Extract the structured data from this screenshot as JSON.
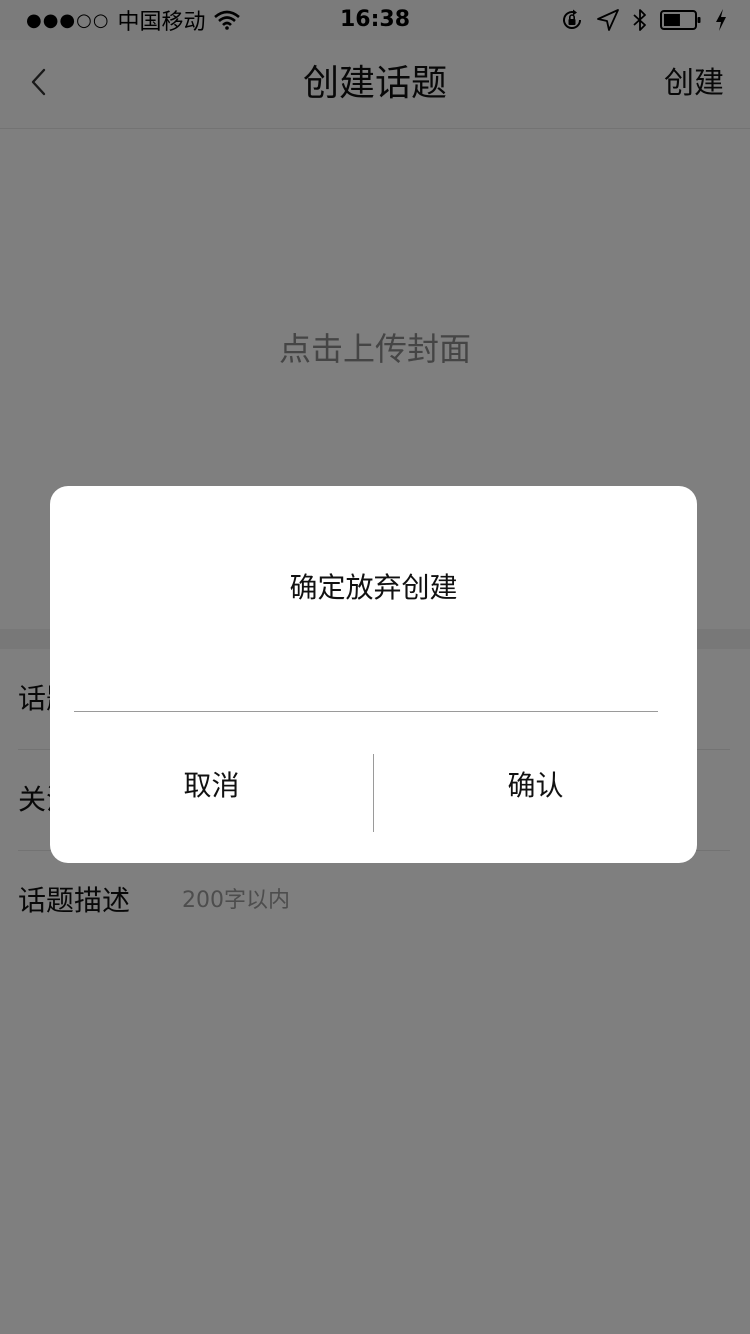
{
  "status_bar": {
    "signal": "●●●○○",
    "carrier": "中国移动",
    "time": "16:38",
    "icons": [
      "wifi-icon",
      "orientation-lock-icon",
      "location-arrow-icon",
      "bluetooth-icon",
      "battery-icon",
      "charging-bolt-icon"
    ],
    "battery_level": 0.55
  },
  "nav": {
    "back_icon": "chevron-left-icon",
    "title": "创建话题",
    "action_label": "创建"
  },
  "cover": {
    "label": "点击上传封面"
  },
  "form": {
    "rows": [
      {
        "label": "话题名称",
        "placeholder": ""
      },
      {
        "label": "关注人群",
        "placeholder": ""
      },
      {
        "label": "话题描述",
        "placeholder": "200字以内"
      }
    ]
  },
  "dialog": {
    "message": "确定放弃创建",
    "cancel_label": "取消",
    "confirm_label": "确认"
  },
  "colors": {
    "overlay": "rgba(0,0,0,0.5)",
    "text": "#111111",
    "placeholder": "#9a9a9a",
    "divider": "#e6e6e6"
  }
}
